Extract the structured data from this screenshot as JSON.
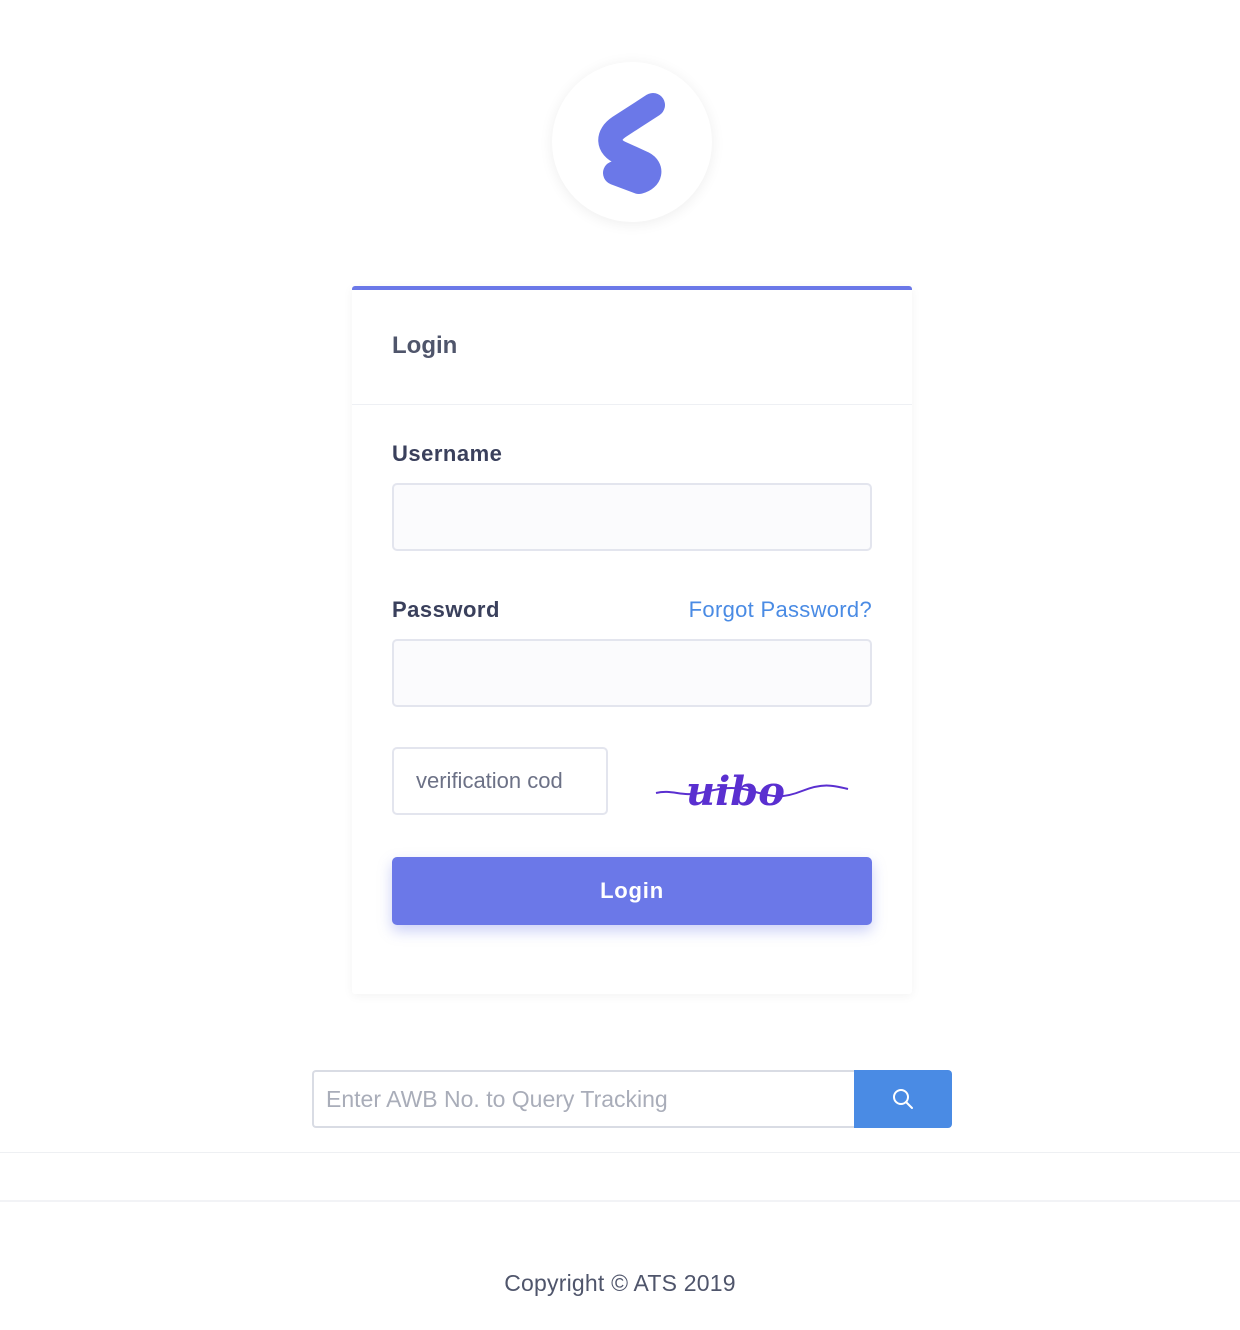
{
  "logo": {
    "icon": "s-logo-icon",
    "color": "#6b78e8"
  },
  "login_card": {
    "title": "Login",
    "username_label": "Username",
    "username_value": "",
    "password_label": "Password",
    "password_value": "",
    "forgot_label": "Forgot Password?",
    "captcha_placeholder": "verification cod",
    "captcha_text": "uibo",
    "login_button": "Login"
  },
  "tracking": {
    "placeholder": "Enter AWB No. to Query Tracking",
    "button_icon": "search-icon"
  },
  "footer": {
    "copyright": "Copyright © ATS 2019"
  },
  "colors": {
    "accent": "#6b78e8",
    "link": "#4a8be4",
    "search_button": "#4a8be4",
    "captcha_ink": "#5a2fd0"
  }
}
